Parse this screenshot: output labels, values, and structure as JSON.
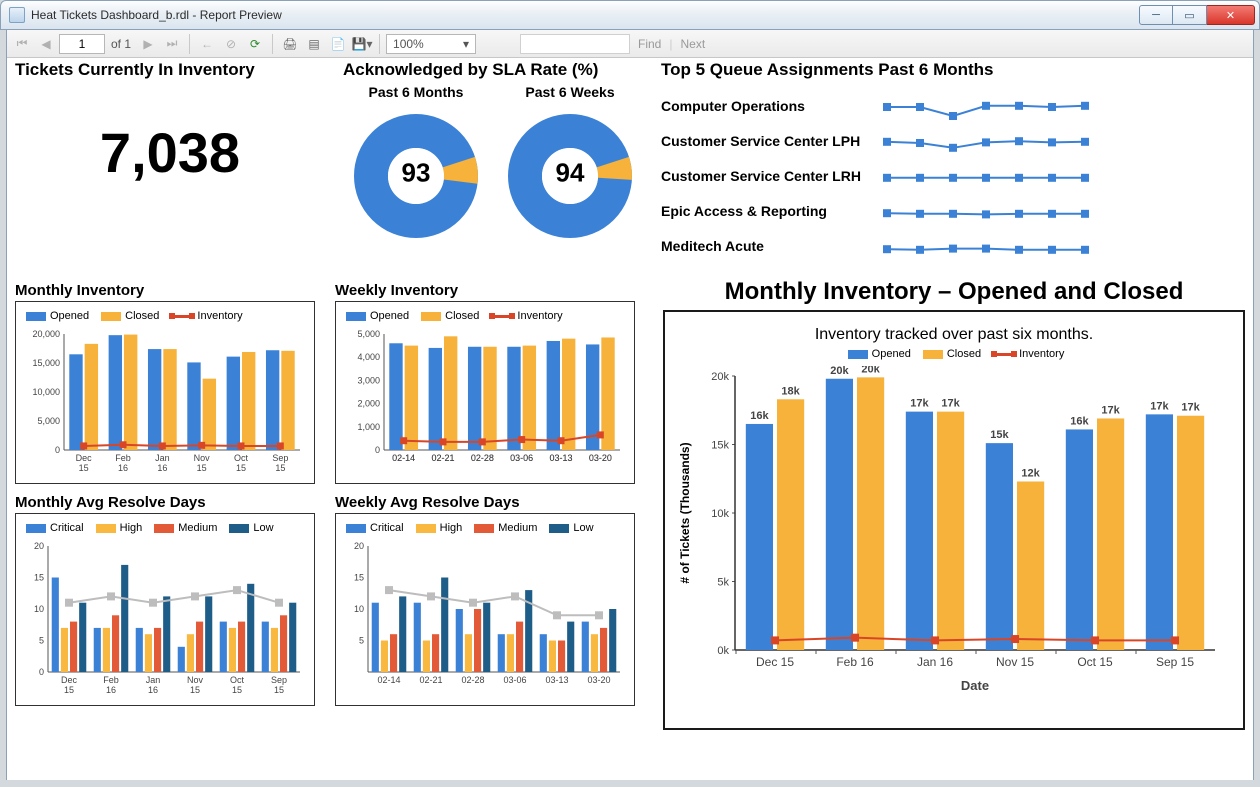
{
  "window": {
    "title": "Heat Tickets Dashboard_b.rdl - Report Preview"
  },
  "toolbar": {
    "page_current": "1",
    "page_of": "of 1",
    "zoom": "100%",
    "find_placeholder": "",
    "find_label": "Find",
    "next_label": "Next"
  },
  "colors": {
    "blue": "#3b82d6",
    "orange": "#f6b23a",
    "red": "#d94627",
    "bar_high": "#f9b941",
    "bar_med": "#e25a37",
    "bar_low": "#1f5d89",
    "gray": "#bdbdbd"
  },
  "kpi": {
    "title": "Tickets Currently In Inventory",
    "value": "7,038"
  },
  "sla": {
    "title": "Acknowledged by SLA Rate (%)",
    "left_label": "Past 6 Months",
    "right_label": "Past 6 Weeks",
    "left_value": 93,
    "right_value": 94
  },
  "queue": {
    "title": "Top 5 Queue Assignments Past 6 Months",
    "items": [
      "Computer Operations",
      "Customer Service Center LPH",
      "Customer Service Center LRH",
      "Epic Access & Reporting",
      "Meditech Acute"
    ],
    "spark": [
      [
        60,
        60,
        45,
        62,
        62,
        60,
        62
      ],
      [
        62,
        60,
        52,
        61,
        63,
        61,
        62
      ],
      [
        62,
        62,
        62,
        62,
        62,
        62,
        62
      ],
      [
        63,
        62,
        62,
        61,
        62,
        62,
        62
      ],
      [
        63,
        62,
        64,
        64,
        62,
        62,
        62
      ]
    ]
  },
  "mini_monthly_inv": {
    "title": "Monthly Inventory",
    "legend": [
      "Opened",
      "Closed",
      "Inventory"
    ],
    "ylim": [
      0,
      20000
    ],
    "yticks": [
      "20,000",
      "15,000",
      "10,000",
      "5,000",
      "0"
    ],
    "categories": [
      "Dec 15",
      "Feb 16",
      "Jan 16",
      "Nov 15",
      "Oct 15",
      "Sep 15"
    ],
    "opened": [
      16500,
      19800,
      17400,
      15100,
      16100,
      17200
    ],
    "closed": [
      18300,
      19900,
      17400,
      12300,
      16900,
      17100
    ],
    "inventory": [
      700,
      900,
      700,
      800,
      700,
      700
    ]
  },
  "mini_weekly_inv": {
    "title": "Weekly Inventory",
    "legend": [
      "Opened",
      "Closed",
      "Inventory"
    ],
    "ylim": [
      0,
      5000
    ],
    "yticks": [
      "5,000",
      "4,000",
      "3,000",
      "2,000",
      "1,000",
      "0"
    ],
    "categories": [
      "02-14",
      "02-21",
      "02-28",
      "03-06",
      "03-13",
      "03-20"
    ],
    "opened": [
      4600,
      4400,
      4450,
      4450,
      4700,
      4550
    ],
    "closed": [
      4500,
      4900,
      4450,
      4500,
      4800,
      4850
    ],
    "inventory": [
      400,
      350,
      350,
      450,
      400,
      650
    ]
  },
  "mini_monthly_avg": {
    "title": "Monthly Avg Resolve Days",
    "legend": [
      "Critical",
      "High",
      "Medium",
      "Low"
    ],
    "ylim": [
      0,
      20
    ],
    "yticks": [
      "20",
      "15",
      "10",
      "5",
      "0"
    ],
    "categories": [
      "Dec 15",
      "Feb 16",
      "Jan 16",
      "Nov 15",
      "Oct 15",
      "Sep 15"
    ],
    "critical": [
      15,
      7,
      7,
      4,
      8,
      8
    ],
    "high": [
      7,
      7,
      6,
      6,
      7,
      7
    ],
    "medium": [
      8,
      9,
      7,
      8,
      8,
      9
    ],
    "low": [
      11,
      17,
      12,
      12,
      14,
      11
    ],
    "gray": [
      11,
      12,
      11,
      12,
      13,
      11
    ]
  },
  "mini_weekly_avg": {
    "title": "Weekly Avg Resolve Days",
    "legend": [
      "Critical",
      "High",
      "Medium",
      "Low"
    ],
    "ylim": [
      0,
      20
    ],
    "yticks": [
      "20",
      "15",
      "10",
      "5"
    ],
    "categories": [
      "02-14",
      "02-21",
      "02-28",
      "03-06",
      "03-13",
      "03-20"
    ],
    "critical": [
      11,
      11,
      10,
      6,
      6,
      8
    ],
    "high": [
      5,
      5,
      6,
      6,
      5,
      6
    ],
    "medium": [
      6,
      6,
      10,
      8,
      5,
      7
    ],
    "low": [
      12,
      15,
      11,
      13,
      8,
      10
    ],
    "gray": [
      13,
      12,
      11,
      12,
      9,
      9
    ]
  },
  "big": {
    "title": "Monthly Inventory – Opened and Closed",
    "subtitle": "Inventory tracked over past six months.",
    "legend": [
      "Opened",
      "Closed",
      "Inventory"
    ],
    "xlabel": "Date",
    "ylabel": "# of Tickets (Thousands)",
    "ylim": [
      0,
      20000
    ],
    "yticks": [
      "20k",
      "15k",
      "10k",
      "5k",
      "0k"
    ],
    "categories": [
      "Dec 15",
      "Feb 16",
      "Jan 16",
      "Nov 15",
      "Oct 15",
      "Sep 15"
    ],
    "opened": [
      16500,
      19800,
      17400,
      15100,
      16100,
      17200
    ],
    "closed": [
      18300,
      19900,
      17400,
      12300,
      16900,
      17100
    ],
    "inventory": [
      700,
      900,
      700,
      800,
      700,
      700
    ],
    "labels_open": [
      "16k",
      "20k",
      "17k",
      "15k",
      "16k",
      "17k"
    ],
    "labels_close": [
      "18k",
      "20k",
      "17k",
      "12k",
      "17k",
      "17k"
    ]
  },
  "chart_data": [
    {
      "name": "sla_past_6_months",
      "type": "pie",
      "title": "Acknowledged by SLA Rate (%) — Past 6 Months",
      "values": {
        "acknowledged": 93,
        "other": 7
      }
    },
    {
      "name": "sla_past_6_weeks",
      "type": "pie",
      "title": "Acknowledged by SLA Rate (%) — Past 6 Weeks",
      "values": {
        "acknowledged": 94,
        "other": 6
      }
    },
    {
      "name": "monthly_inventory",
      "type": "bar",
      "title": "Monthly Inventory",
      "categories": [
        "Dec 15",
        "Feb 16",
        "Jan 16",
        "Nov 15",
        "Oct 15",
        "Sep 15"
      ],
      "series": [
        {
          "name": "Opened",
          "values": [
            16500,
            19800,
            17400,
            15100,
            16100,
            17200
          ]
        },
        {
          "name": "Closed",
          "values": [
            18300,
            19900,
            17400,
            12300,
            16900,
            17100
          ]
        },
        {
          "name": "Inventory",
          "values": [
            700,
            900,
            700,
            800,
            700,
            700
          ]
        }
      ],
      "ylim": [
        0,
        20000
      ]
    },
    {
      "name": "weekly_inventory",
      "type": "bar",
      "title": "Weekly Inventory",
      "categories": [
        "02-14",
        "02-21",
        "02-28",
        "03-06",
        "03-13",
        "03-20"
      ],
      "series": [
        {
          "name": "Opened",
          "values": [
            4600,
            4400,
            4450,
            4450,
            4700,
            4550
          ]
        },
        {
          "name": "Closed",
          "values": [
            4500,
            4900,
            4450,
            4500,
            4800,
            4850
          ]
        },
        {
          "name": "Inventory",
          "values": [
            400,
            350,
            350,
            450,
            400,
            650
          ]
        }
      ],
      "ylim": [
        0,
        5000
      ]
    },
    {
      "name": "monthly_avg_resolve_days",
      "type": "bar",
      "title": "Monthly Avg Resolve Days",
      "categories": [
        "Dec 15",
        "Feb 16",
        "Jan 16",
        "Nov 15",
        "Oct 15",
        "Sep 15"
      ],
      "series": [
        {
          "name": "Critical",
          "values": [
            15,
            7,
            7,
            4,
            8,
            8
          ]
        },
        {
          "name": "High",
          "values": [
            7,
            7,
            6,
            6,
            7,
            7
          ]
        },
        {
          "name": "Medium",
          "values": [
            8,
            9,
            7,
            8,
            8,
            9
          ]
        },
        {
          "name": "Low",
          "values": [
            11,
            17,
            12,
            12,
            14,
            11
          ]
        }
      ],
      "ylim": [
        0,
        20
      ]
    },
    {
      "name": "weekly_avg_resolve_days",
      "type": "bar",
      "title": "Weekly Avg Resolve Days",
      "categories": [
        "02-14",
        "02-21",
        "02-28",
        "03-06",
        "03-13",
        "03-20"
      ],
      "series": [
        {
          "name": "Critical",
          "values": [
            11,
            11,
            10,
            6,
            6,
            8
          ]
        },
        {
          "name": "High",
          "values": [
            5,
            5,
            6,
            6,
            5,
            6
          ]
        },
        {
          "name": "Medium",
          "values": [
            6,
            6,
            10,
            8,
            5,
            7
          ]
        },
        {
          "name": "Low",
          "values": [
            12,
            15,
            11,
            13,
            8,
            10
          ]
        }
      ],
      "ylim": [
        0,
        20
      ]
    },
    {
      "name": "monthly_inventory_opened_closed",
      "type": "bar",
      "title": "Monthly Inventory – Opened and Closed",
      "xlabel": "Date",
      "ylabel": "# of Tickets (Thousands)",
      "categories": [
        "Dec 15",
        "Feb 16",
        "Jan 16",
        "Nov 15",
        "Oct 15",
        "Sep 15"
      ],
      "series": [
        {
          "name": "Opened",
          "values": [
            16500,
            19800,
            17400,
            15100,
            16100,
            17200
          ]
        },
        {
          "name": "Closed",
          "values": [
            18300,
            19900,
            17400,
            12300,
            16900,
            17100
          ]
        },
        {
          "name": "Inventory",
          "values": [
            700,
            900,
            700,
            800,
            700,
            700
          ]
        }
      ],
      "ylim": [
        0,
        20000
      ]
    }
  ]
}
